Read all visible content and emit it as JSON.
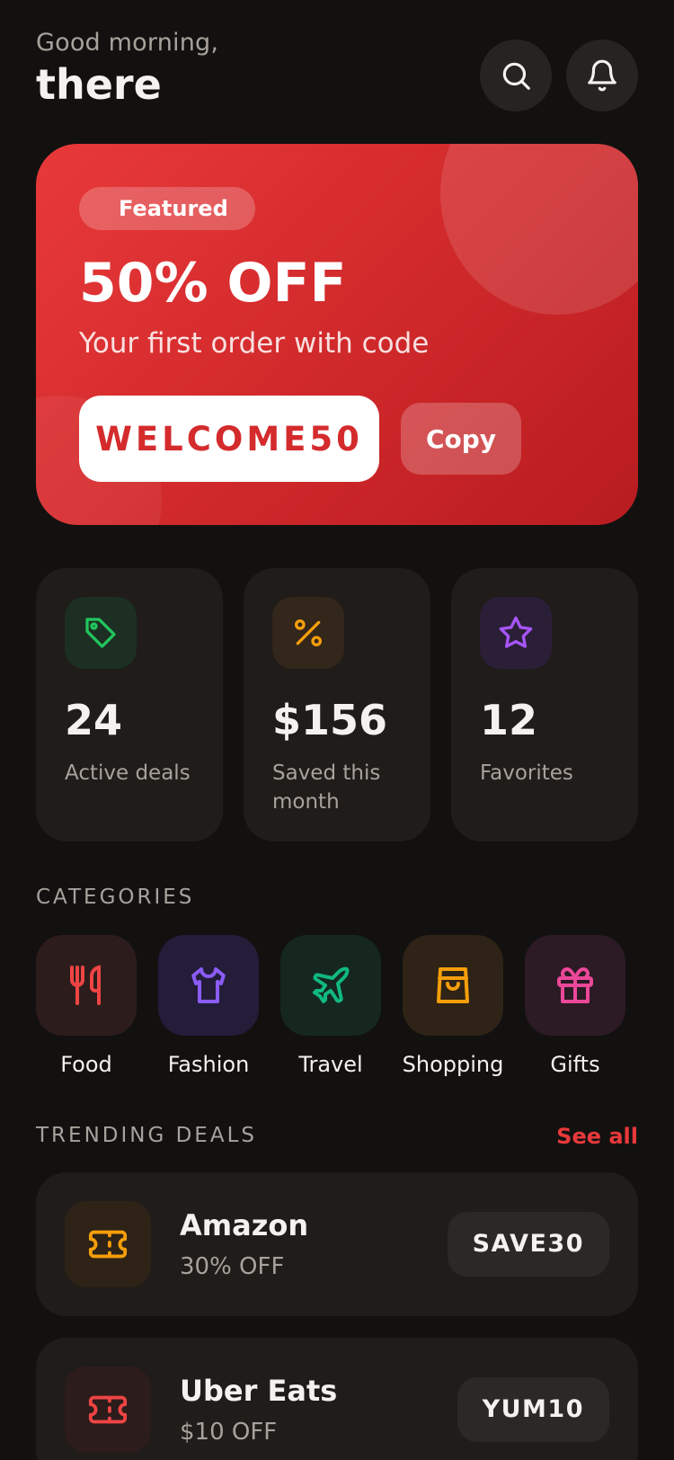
{
  "header": {
    "greeting": "Good morning,",
    "name": "there"
  },
  "icons": {
    "search": "search-icon",
    "notifications": "bell-icon"
  },
  "featured": {
    "badge": "Featured",
    "title": "50% OFF",
    "description": "Your first order with code",
    "code": "WELCOME50",
    "copy_label": "Copy",
    "accent": "#e8393a"
  },
  "stats": [
    {
      "value": "24",
      "label": "Active deals",
      "icon": "tag-icon",
      "color": "#22c55e"
    },
    {
      "value": "$156",
      "label": "Saved this month",
      "icon": "percent-icon",
      "color": "#f59e0b"
    },
    {
      "value": "12",
      "label": "Favorites",
      "icon": "star-icon",
      "color": "#a855f7"
    }
  ],
  "categories": {
    "title": "CATEGORIES",
    "items": [
      {
        "label": "Food",
        "icon": "utensils-icon",
        "color": "#ef4444"
      },
      {
        "label": "Fashion",
        "icon": "shirt-icon",
        "color": "#8b5cf6"
      },
      {
        "label": "Travel",
        "icon": "plane-icon",
        "color": "#10b981"
      },
      {
        "label": "Shopping",
        "icon": "shopping-bag-icon",
        "color": "#f59e0b"
      },
      {
        "label": "Gifts",
        "icon": "gift-icon",
        "color": "#ec4899"
      }
    ]
  },
  "trending": {
    "title": "TRENDING DEALS",
    "see_all": "See all",
    "deals": [
      {
        "store": "Amazon",
        "offer": "30% OFF",
        "code": "SAVE30",
        "icon": "ticket-icon",
        "color": "#f59e0b"
      },
      {
        "store": "Uber Eats",
        "offer": "$10 OFF",
        "code": "YUM10",
        "icon": "ticket-icon",
        "color": "#ef4444"
      }
    ]
  }
}
